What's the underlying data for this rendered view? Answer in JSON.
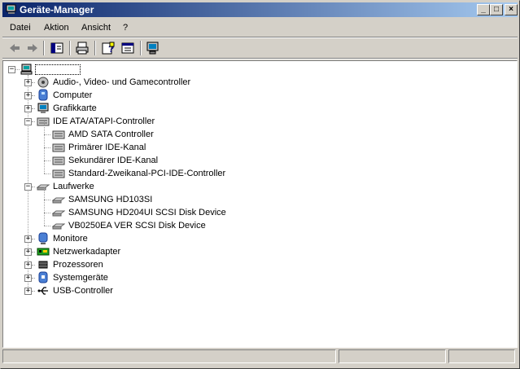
{
  "window": {
    "title": "Geräte-Manager"
  },
  "titlebar_buttons": {
    "minimize": "_",
    "maximize": "□",
    "close": "×"
  },
  "menu": [
    "Datei",
    "Aktion",
    "Ansicht",
    "?"
  ],
  "toolbar": {
    "buttons": [
      "back-icon",
      "forward-icon",
      "console-tree-icon",
      "print-icon",
      "help-icon",
      "properties-icon",
      "scan-hardware-icon"
    ]
  },
  "tree": {
    "root_label": "",
    "categories": [
      {
        "label": "Audio-, Video- und Gamecontroller",
        "icon": "audio-icon",
        "expanded": false,
        "children": []
      },
      {
        "label": "Computer",
        "icon": "computer-icon",
        "expanded": false,
        "children": []
      },
      {
        "label": "Grafikkarte",
        "icon": "display-adapter-icon",
        "expanded": false,
        "children": []
      },
      {
        "label": "IDE ATA/ATAPI-Controller",
        "icon": "ide-controller-icon",
        "expanded": true,
        "children": [
          "AMD SATA Controller",
          "Primärer IDE-Kanal",
          "Sekundärer IDE-Kanal",
          "Standard-Zweikanal-PCI-IDE-Controller"
        ]
      },
      {
        "label": "Laufwerke",
        "icon": "disk-drive-icon",
        "expanded": true,
        "children": [
          "SAMSUNG HD103SI",
          "SAMSUNG HD204UI SCSI Disk Device",
          "VB0250EA VER SCSI Disk Device"
        ]
      },
      {
        "label": "Monitore",
        "icon": "monitor-icon",
        "expanded": false,
        "children": []
      },
      {
        "label": "Netzwerkadapter",
        "icon": "network-adapter-icon",
        "expanded": false,
        "children": []
      },
      {
        "label": "Prozessoren",
        "icon": "processor-icon",
        "expanded": false,
        "children": []
      },
      {
        "label": "Systemgeräte",
        "icon": "system-device-icon",
        "expanded": false,
        "children": []
      },
      {
        "label": "USB-Controller",
        "icon": "usb-icon",
        "expanded": false,
        "children": []
      }
    ]
  },
  "colors": {
    "title_start": "#0a246a",
    "title_end": "#a6caf0",
    "face": "#d4d0c8"
  }
}
